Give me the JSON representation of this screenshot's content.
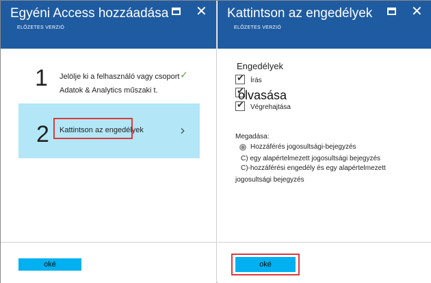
{
  "left_blade": {
    "title": "Egyéni Access hozzáadása",
    "subtitle": "ELŐZETES VERZIÓ",
    "step1": {
      "number": "1",
      "line1": "Jelölje ki a felhasználó vagy csoport",
      "line2": "Adatok & Analytics műszaki t."
    },
    "step2": {
      "number": "2",
      "label": "Kattintson az engedélyek"
    },
    "ok_label": "oké"
  },
  "right_blade": {
    "title": "Kattintson az engedélyek",
    "subtitle": "ELŐZETES VERZIÓ",
    "permissions_heading": "Engedélyek",
    "permissions": [
      {
        "label": "Írás",
        "checked": true
      },
      {
        "label": "olvasása",
        "checked": true
      },
      {
        "label": "Végrehajtása",
        "checked": true
      }
    ],
    "grant_title": "Megadása:",
    "options": [
      "Hozzáférés jogosultsági-bejegyzés",
      "C) egy alapértelmezett jogosultsági bejegyzés",
      "C)-hozzáférési engedély és egy alapértelmezett",
      "jogosultsági bejegyzés"
    ],
    "ok_label": "oké"
  },
  "colors": {
    "header_bg": "#1f5ba0",
    "selected_step_bg": "#b3e7f7",
    "ok_button_bg": "#00b0f0",
    "highlight_border": "#d9393b",
    "check_green": "#5ba33b"
  }
}
